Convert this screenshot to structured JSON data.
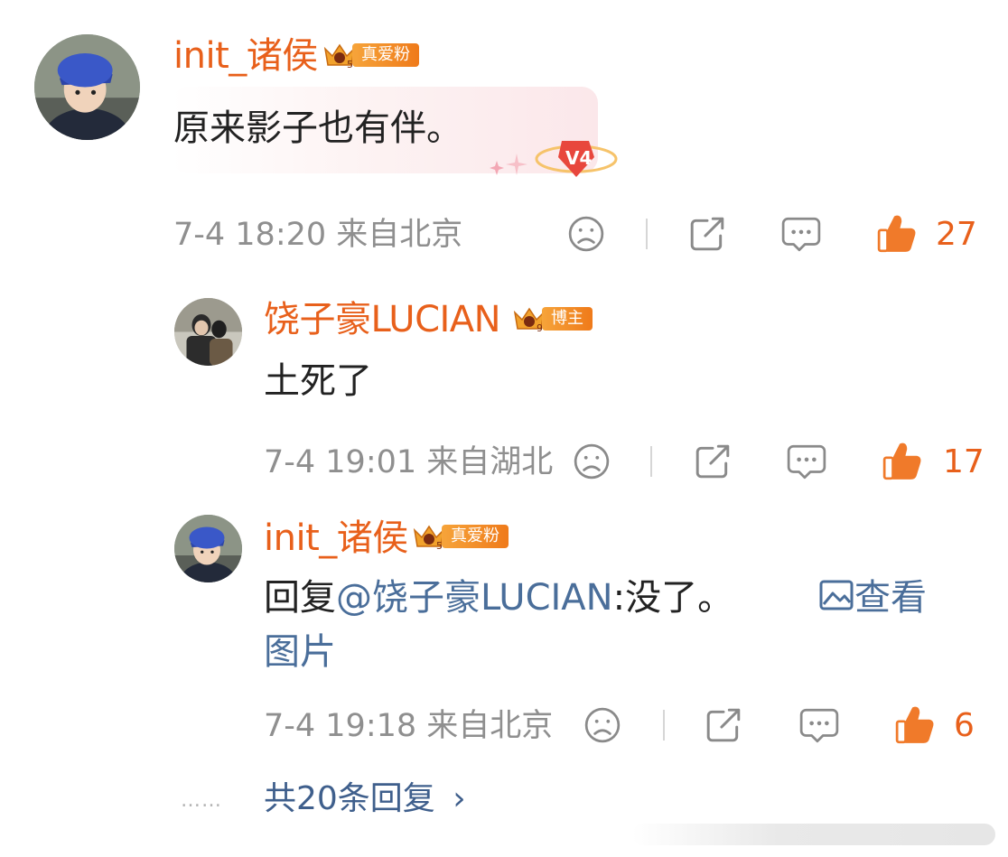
{
  "comments": [
    {
      "username": "init_诸侯",
      "badge_label": "真爱粉",
      "badge_level": "5",
      "text": "原来影子也有伴。",
      "bubble_badge": "V4",
      "time": "7-4 18:20",
      "location": "来自北京",
      "likes": "27"
    },
    {
      "username": "饶子豪LUCIAN",
      "badge_label": "博主",
      "badge_level": "9",
      "text": "土死了",
      "time": "7-4 19:01",
      "location": "来自湖北",
      "likes": "17"
    },
    {
      "username": "init_诸侯",
      "badge_label": "真爱粉",
      "badge_level": "5",
      "reply_prefix": "回复",
      "mention": "@饶子豪LUCIAN",
      "reply_text": ":没了。",
      "view_image_label": "查看",
      "view_image_label_2": "图片",
      "time": "7-4 19:18",
      "location": "来自北京",
      "likes": "6"
    }
  ],
  "more_replies": "共20条回复",
  "more_dots": "……",
  "more_chevron": "›",
  "icons": [
    "dislike-icon",
    "share-icon",
    "comment-icon",
    "like-icon",
    "image-icon",
    "crown-icon",
    "chevron-right-icon"
  ],
  "colors": {
    "username": "#e8601b",
    "meta": "#8f8f8f",
    "link": "#4a6e9a",
    "like": "#f07a2a",
    "badge": "#f08a24"
  }
}
